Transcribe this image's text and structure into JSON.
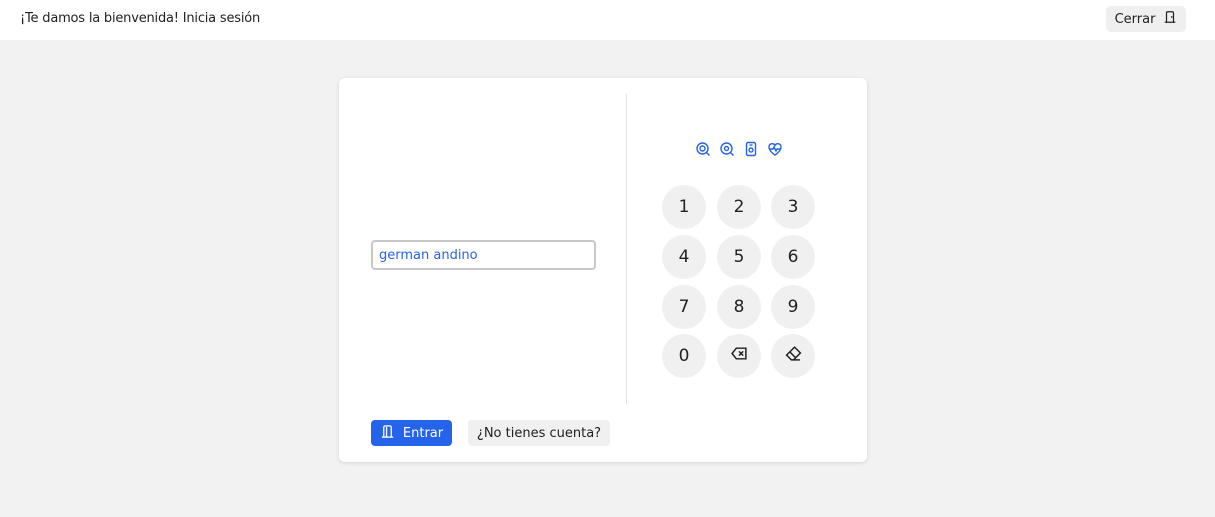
{
  "header": {
    "welcome_text": "¡Te damos la bienvenida! Inicia sesión",
    "close_label": "Cerrar",
    "close_icon": "door-icon"
  },
  "login": {
    "username_value": "german andino",
    "auth_icons": [
      "fingerprint-icon",
      "face-id-icon",
      "device-icon",
      "heart-pulse-icon"
    ],
    "keypad": {
      "keys": [
        "1",
        "2",
        "3",
        "4",
        "5",
        "6",
        "7",
        "8",
        "9",
        "0"
      ],
      "backspace_icon": "backspace-icon",
      "clear_icon": "eraser-icon"
    },
    "enter_label": "Entrar",
    "enter_icon": "door-icon",
    "signup_label": "¿No tienes cuenta?"
  },
  "colors": {
    "accent": "#2563eb",
    "background": "#f2f2f2",
    "card": "#ffffff",
    "key_background": "#f0f0f0"
  }
}
